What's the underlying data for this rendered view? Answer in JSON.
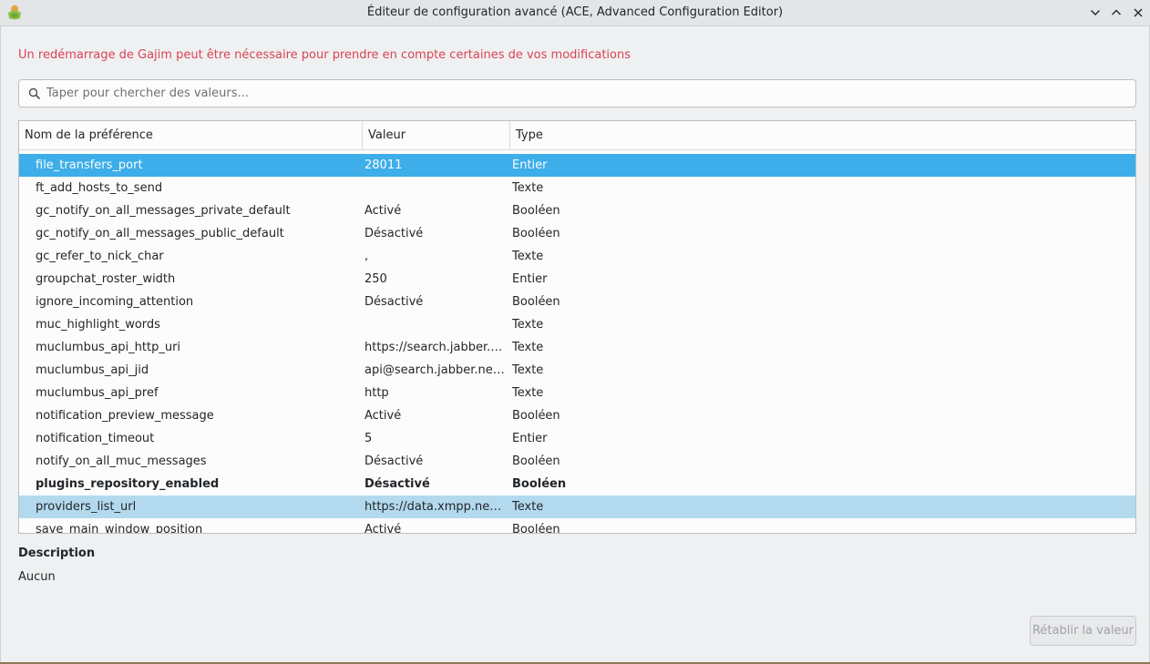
{
  "window": {
    "title": "Éditeur de configuration avancé (ACE, Advanced Configuration Editor)"
  },
  "warning": "Un redémarrage de Gajim peut être nécessaire pour prendre en compte certaines de vos modifications",
  "search": {
    "placeholder": "Taper pour chercher des valeurs...",
    "value": ""
  },
  "table": {
    "columns": [
      "Nom de la préférence",
      "Valeur",
      "Type"
    ],
    "rows": [
      {
        "name": "file_transfers_port",
        "value": "28011",
        "type": "Entier",
        "state": "selected"
      },
      {
        "name": "ft_add_hosts_to_send",
        "value": "",
        "type": "Texte"
      },
      {
        "name": "gc_notify_on_all_messages_private_default",
        "value": "Activé",
        "type": "Booléen"
      },
      {
        "name": "gc_notify_on_all_messages_public_default",
        "value": "Désactivé",
        "type": "Booléen"
      },
      {
        "name": "gc_refer_to_nick_char",
        "value": ",",
        "type": "Texte"
      },
      {
        "name": "groupchat_roster_width",
        "value": "250",
        "type": "Entier"
      },
      {
        "name": "ignore_incoming_attention",
        "value": "Désactivé",
        "type": "Booléen"
      },
      {
        "name": "muc_highlight_words",
        "value": "",
        "type": "Texte"
      },
      {
        "name": "muclumbus_api_http_uri",
        "value": "https://search.jabber.n...",
        "type": "Texte"
      },
      {
        "name": "muclumbus_api_jid",
        "value": "api@search.jabber.net...",
        "type": "Texte"
      },
      {
        "name": "muclumbus_api_pref",
        "value": "http",
        "type": "Texte"
      },
      {
        "name": "notification_preview_message",
        "value": "Activé",
        "type": "Booléen"
      },
      {
        "name": "notification_timeout",
        "value": "5",
        "type": "Entier"
      },
      {
        "name": "notify_on_all_muc_messages",
        "value": "Désactivé",
        "type": "Booléen"
      },
      {
        "name": "plugins_repository_enabled",
        "value": "Désactivé",
        "type": "Booléen",
        "bold": true
      },
      {
        "name": "providers_list_url",
        "value": "https://data.xmpp.net/...",
        "type": "Texte",
        "state": "hover"
      },
      {
        "name": "save_main_window_position",
        "value": "Activé",
        "type": "Booléen"
      }
    ]
  },
  "description": {
    "title": "Description",
    "text": "Aucun"
  },
  "buttons": {
    "reset": "Rétablir la valeur"
  },
  "colors": {
    "selection": "#3daee9",
    "hover": "#b3d9ee",
    "warning": "#da4453"
  }
}
